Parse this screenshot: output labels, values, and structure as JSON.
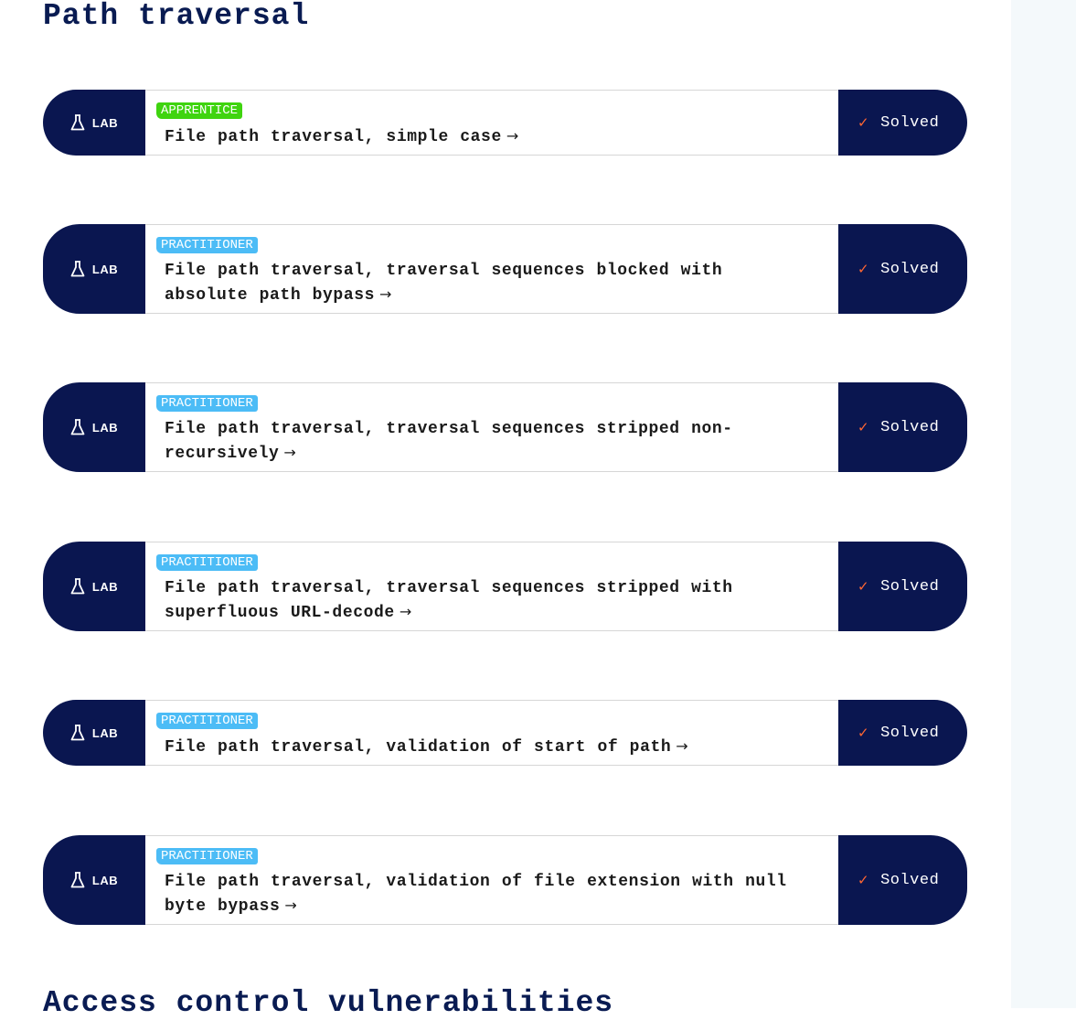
{
  "sections": {
    "current_title": "Path traversal",
    "next_title": "Access control vulnerabilities"
  },
  "lab_badge": "LAB",
  "arrow_glyph": "→",
  "check_glyph": "✓",
  "level_colors": {
    "apprentice": "#3fd40f",
    "practitioner": "#4cbcf6"
  },
  "accent_color": "#0a1650",
  "labs": [
    {
      "level": "APPRENTICE",
      "title": "File path traversal, simple case",
      "status": "Solved"
    },
    {
      "level": "PRACTITIONER",
      "title": "File path traversal, traversal sequences blocked with absolute path bypass",
      "status": "Solved"
    },
    {
      "level": "PRACTITIONER",
      "title": "File path traversal, traversal sequences stripped non-recursively",
      "status": "Solved"
    },
    {
      "level": "PRACTITIONER",
      "title": "File path traversal, traversal sequences stripped with superfluous URL-decode",
      "status": "Solved"
    },
    {
      "level": "PRACTITIONER",
      "title": "File path traversal, validation of start of path",
      "status": "Solved"
    },
    {
      "level": "PRACTITIONER",
      "title": "File path traversal, validation of file extension with null byte bypass",
      "status": "Solved"
    }
  ]
}
